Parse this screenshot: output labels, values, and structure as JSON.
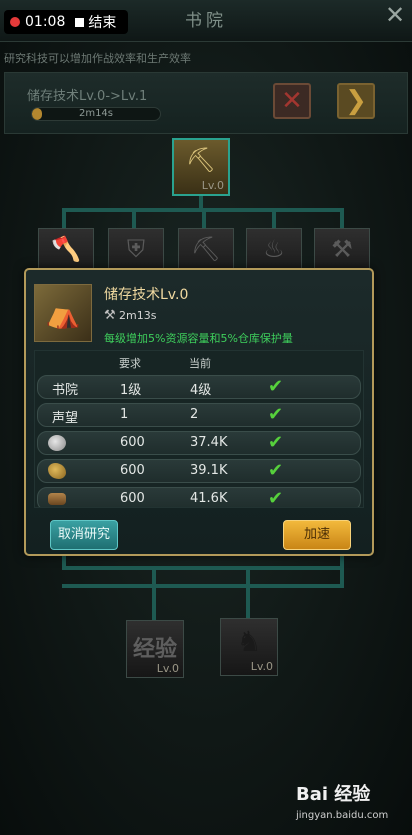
{
  "status_overlay": {
    "time": "01:08",
    "end_label": "结束"
  },
  "header": {
    "title": "书院",
    "close_icon": "close-icon"
  },
  "hint": "研究科技可以增加作战效率和生产效率",
  "progress": {
    "label": "储存技术Lv.0->Lv.1",
    "time": "2m14s",
    "fill_fraction": 0.08
  },
  "tree": {
    "top_node_level": "Lv.0",
    "bottom_nodes": [
      {
        "text": "经验",
        "level": "Lv.0"
      },
      {
        "text": "",
        "level": "Lv.0"
      }
    ]
  },
  "modal": {
    "title": "储存技术Lv.0",
    "time": "2m13s",
    "description": "每级增加5%资源容量和5%仓库保护量",
    "table": {
      "header_required": "要求",
      "header_current": "当前",
      "rows": [
        {
          "name": "书院",
          "required": "1级",
          "current": "4级",
          "icon": ""
        },
        {
          "name": "声望",
          "required": "1",
          "current": "2",
          "icon": ""
        },
        {
          "name": "",
          "required": "600",
          "current": "37.4K",
          "icon": "silver-icon"
        },
        {
          "name": "",
          "required": "600",
          "current": "39.1K",
          "icon": "wheat-icon"
        },
        {
          "name": "",
          "required": "600",
          "current": "41.6K",
          "icon": "wood-icon"
        }
      ]
    },
    "cancel_label": "取消研究",
    "speedup_label": "加速"
  },
  "watermark": {
    "main": "Bai 经验",
    "sub": "jingyan.baidu.com"
  },
  "colors": {
    "accent_gold": "#b39a5a",
    "check_green": "#56d13c",
    "desc_green": "#3ecf5c"
  }
}
